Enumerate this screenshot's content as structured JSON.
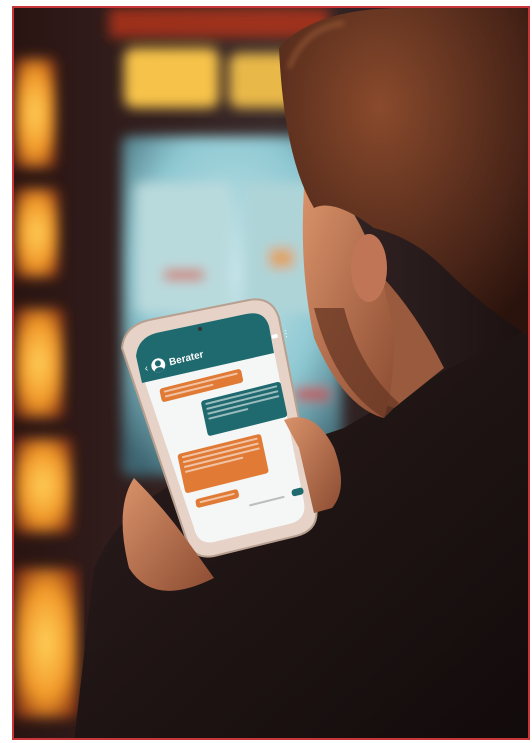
{
  "phone": {
    "chat_title": "Berater"
  },
  "colors": {
    "frame_border": "#c8363a",
    "header_teal": "#1f6a6f",
    "bubble_orange": "#e07a35",
    "bubble_teal": "#1f6a6f",
    "background_light_amber": "#f2a53a"
  },
  "icons": {
    "back": "chevron-left-icon",
    "profile": "avatar-icon",
    "video": "video-camera-icon",
    "menu": "more-vertical-icon"
  }
}
